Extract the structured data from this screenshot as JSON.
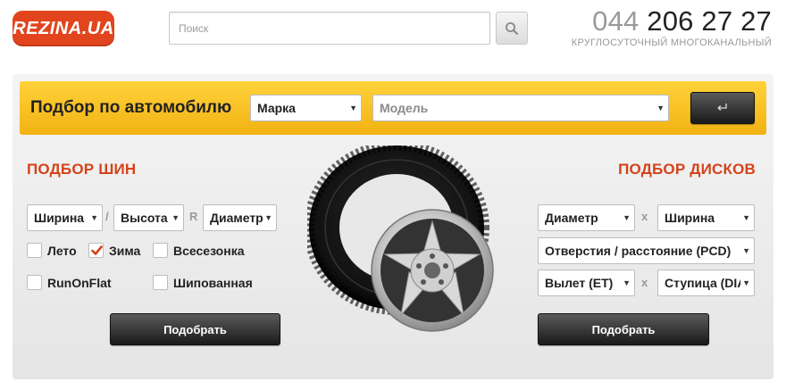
{
  "header": {
    "logo_text": "REZINA.UA",
    "search_placeholder": "Поиск",
    "phone_code": "044",
    "phone_number": "206 27 27",
    "phone_caption": "КРУГЛОСУТОЧНЫЙ МНОГОКАНАЛЬНЫЙ"
  },
  "car_selection": {
    "title": "Подбор по автомобилю",
    "make_select": "Марка",
    "model_select": "Модель",
    "submit_icon": "return-arrow-icon"
  },
  "tires": {
    "title": "ПОДБОР ШИН",
    "width_select": "Ширина",
    "height_select": "Высота",
    "separator_slash": "/",
    "separator_r": "R",
    "diameter_select": "Диаметр",
    "checkboxes": [
      {
        "label": "Лето",
        "checked": false
      },
      {
        "label": "Зима",
        "checked": true
      },
      {
        "label": "Всесезонка",
        "checked": false
      },
      {
        "label": "RunOnFlat",
        "checked": false
      },
      {
        "label": "Шипованная",
        "checked": false
      }
    ],
    "submit_label": "Подобрать"
  },
  "discs": {
    "title": "ПОДБОР ДИСКОВ",
    "diameter_select": "Диаметр",
    "width_select": "Ширина",
    "separator_x": "x",
    "pcd_select": "Отверстия / расстояние (PCD)",
    "et_select": "Вылет (ET)",
    "dia_select": "Ступица (DIA)",
    "submit_label": "Подобрать"
  },
  "colors": {
    "accent": "#e2451e",
    "yellow_bar": "#f7c223",
    "section_title": "#d4431a",
    "check_mark": "#d4431a"
  }
}
